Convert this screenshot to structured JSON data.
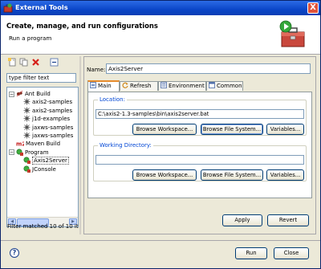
{
  "window": {
    "title": "External Tools",
    "close_glyph": "X"
  },
  "header": {
    "heading": "Create, manage, and run configurations",
    "subheading": "Run a program",
    "icon": "toolbox-run-icon"
  },
  "left": {
    "toolbar": [
      {
        "name": "new-configuration-icon"
      },
      {
        "name": "duplicate-icon"
      },
      {
        "name": "delete-icon"
      },
      {
        "name": "collapse-all-icon"
      }
    ],
    "filter_value": "type filter text",
    "tree": [
      {
        "label": "Ant Build",
        "type": "ant",
        "level": 0,
        "expanded": true
      },
      {
        "label": "axis2-samples",
        "type": "ant-item",
        "level": 1
      },
      {
        "label": "axis2-samples",
        "type": "ant-item",
        "level": 1
      },
      {
        "label": "j1d-examples",
        "type": "ant-item",
        "level": 1
      },
      {
        "label": "jaxws-samples",
        "type": "ant-item",
        "level": 1
      },
      {
        "label": "jaxws-samples",
        "type": "ant-item",
        "level": 1
      },
      {
        "label": "Maven Build",
        "type": "maven",
        "level": 0
      },
      {
        "label": "Program",
        "type": "program",
        "level": 0,
        "expanded": true
      },
      {
        "label": "Axis2Server",
        "type": "program-item",
        "level": 1,
        "selected": true
      },
      {
        "label": "JConsole",
        "type": "program-item",
        "level": 1
      }
    ],
    "status": "Filter matched 10 of 10 it"
  },
  "right": {
    "name_label": "Name:",
    "name_value": "Axis2Server",
    "tabs": [
      {
        "label": "Main",
        "active": true,
        "icon": "main-tab-icon"
      },
      {
        "label": "Refresh",
        "active": false,
        "icon": "refresh-tab-icon"
      },
      {
        "label": "Environment",
        "active": false,
        "icon": "environment-tab-icon"
      },
      {
        "label": "Common",
        "active": false,
        "icon": "common-tab-icon"
      }
    ],
    "location": {
      "label": "Location:",
      "value": "C:\\axis2-1.3-samples\\bin\\axis2server.bat",
      "buttons": [
        "Browse Workspace...",
        "Browse File System...",
        "Variables..."
      ]
    },
    "working_dir": {
      "label": "Working Directory:",
      "value": "",
      "buttons": [
        "Browse Workspace...",
        "Browse File System...",
        "Variables..."
      ]
    },
    "apply": "Apply",
    "revert": "Revert"
  },
  "footer": {
    "run": "Run",
    "close": "Close",
    "help_glyph": "?"
  },
  "colors": {
    "title_bar": "#0b46c8",
    "accent_tab": "#e68b2c",
    "group_label": "#0046d5"
  }
}
